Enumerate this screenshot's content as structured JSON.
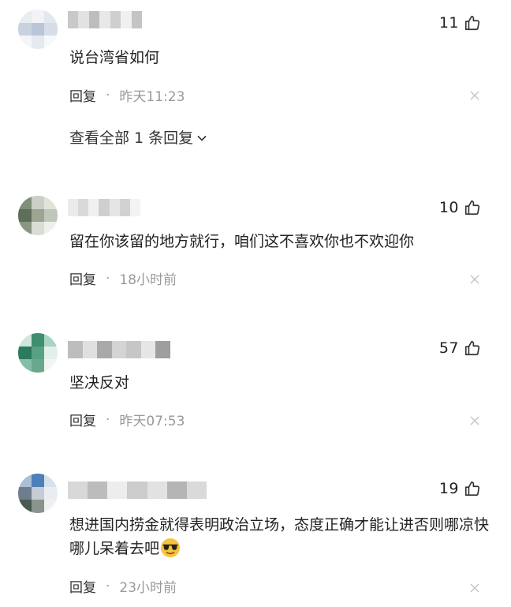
{
  "comments": [
    {
      "text": "说台湾省如何",
      "likes": "11",
      "reply_label": "回复",
      "separator": "·",
      "time": "昨天11:23",
      "view_replies": "查看全部 1 条回复",
      "avatar_colors": [
        "#e9ecf1",
        "#f1f3f6",
        "#e3e8ee",
        "#c9d3df",
        "#b8c6d8",
        "#d6dde7",
        "#f4f5f7",
        "#e6eaf0",
        "#f7f8fa"
      ],
      "name_colors": [
        "#c9c9c9",
        "#e2e2e2",
        "#bdbdbd",
        "#e8e8e8",
        "#cfcfcf",
        "#f0f0f0",
        "#c4c4c4"
      ]
    },
    {
      "text": "留在你该留的地方就行，咱们这不喜欢你也不欢迎你",
      "likes": "10",
      "reply_label": "回复",
      "separator": "·",
      "time": "18小时前",
      "avatar_colors": [
        "#7f8f78",
        "#c9cfc4",
        "#dfe3da",
        "#5e6e5a",
        "#9aa592",
        "#c0c6b9",
        "#8a9584",
        "#d9ddd3",
        "#eef0eb"
      ],
      "name_colors": [
        "#ebebeb",
        "#d9d9d9",
        "#f0f0f0",
        "#cfcfcf",
        "#e5e5e5",
        "#d2d2d2",
        "#f3f3f3"
      ]
    },
    {
      "text": "坚决反对",
      "likes": "57",
      "reply_label": "回复",
      "separator": "·",
      "time": "昨天07:53",
      "avatar_colors": [
        "#cfe6dc",
        "#3f8f6f",
        "#a9d3c2",
        "#2d7a5d",
        "#58a184",
        "#e3efe9",
        "#86bda6",
        "#6aa88d",
        "#f1f6f3"
      ],
      "name_colors": [
        "#bdbdbd",
        "#e0e0e0",
        "#a9a9a9",
        "#d4d4d4",
        "#c6c6c6",
        "#e6e6e6",
        "#9e9e9e"
      ]
    },
    {
      "text": "想进国内捞金就得表明政治立场，态度正确才能让进否则哪凉快哪儿呆着去吧",
      "likes": "19",
      "reply_label": "回复",
      "separator": "·",
      "time": "23小时前",
      "avatar_colors": [
        "#a9bfd8",
        "#4d7fb8",
        "#d7e1ec",
        "#6f7d8c",
        "#c6ccd3",
        "#e9edf1",
        "#4a5a4f",
        "#8a948d",
        "#eef0f2"
      ],
      "name_colors": [
        "#d8d8d8",
        "#bcbcbc",
        "#ededed",
        "#cccccc",
        "#e2e2e2",
        "#b5b5b5",
        "#dadada"
      ]
    }
  ]
}
